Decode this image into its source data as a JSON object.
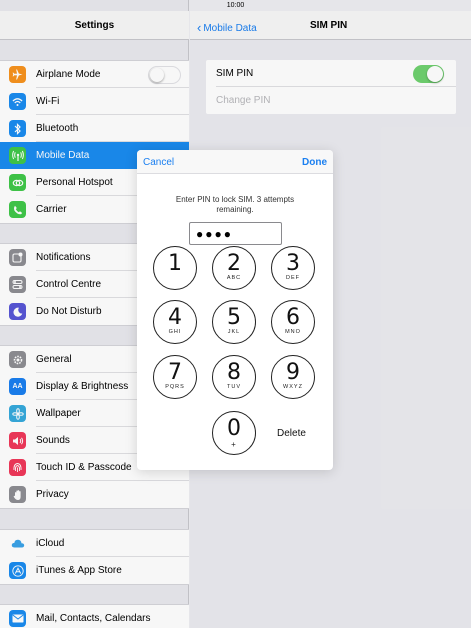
{
  "status_bar": {
    "signal": "●●●●●",
    "time": "10:00"
  },
  "left_panel": {
    "title": "Settings",
    "groups": [
      {
        "items": [
          {
            "label": "Airplane Mode",
            "icon": "airplane-icon",
            "color": "#f7931e"
          },
          {
            "label": "Wi-Fi",
            "icon": "wifi-icon",
            "color": "#1a8cf0"
          },
          {
            "label": "Bluetooth",
            "icon": "bluetooth-icon",
            "color": "#1a8cf0"
          },
          {
            "label": "Mobile Data",
            "icon": "antenna-icon",
            "color": "#41c84a"
          },
          {
            "label": "Personal Hotspot",
            "icon": "hotspot-icon",
            "color": "#41c84a"
          },
          {
            "label": "Carrier",
            "icon": "phone-icon",
            "color": "#41c84a"
          }
        ]
      },
      {
        "items": [
          {
            "label": "Notifications",
            "icon": "notifications-icon",
            "color": "#8e8e93"
          },
          {
            "label": "Control Centre",
            "icon": "control-centre-icon",
            "color": "#8e8e93"
          },
          {
            "label": "Do Not Disturb",
            "icon": "moon-icon",
            "color": "#5856d6"
          }
        ]
      },
      {
        "items": [
          {
            "label": "General",
            "icon": "gear-icon",
            "color": "#8e8e93"
          },
          {
            "label": "Display & Brightness",
            "icon": "text-size-icon",
            "color": "#1a7ff0"
          },
          {
            "label": "Wallpaper",
            "icon": "wallpaper-icon",
            "color": "#36aadc"
          },
          {
            "label": "Sounds",
            "icon": "speaker-icon",
            "color": "#f0385a"
          },
          {
            "label": "Touch ID & Passcode",
            "icon": "fingerprint-icon",
            "color": "#f0385a"
          },
          {
            "label": "Privacy",
            "icon": "hand-icon",
            "color": "#8e8e93"
          }
        ]
      },
      {
        "items": [
          {
            "label": "iCloud",
            "icon": "cloud-icon",
            "color": "#ffffff"
          },
          {
            "label": "iTunes & App Store",
            "icon": "app-store-icon",
            "color": "#1a8cf0"
          }
        ]
      },
      {
        "items": [
          {
            "label": "Mail, Contacts, Calendars",
            "icon": "mail-icon",
            "color": "#1a8cf0"
          }
        ]
      }
    ],
    "selected": "Mobile Data"
  },
  "right_panel": {
    "back_label": "Mobile Data",
    "title": "SIM PIN",
    "rows": [
      {
        "label": "SIM PIN",
        "toggle": "on"
      },
      {
        "label": "Change PIN",
        "disabled": true
      }
    ]
  },
  "pin_modal": {
    "cancel_label": "Cancel",
    "done_label": "Done",
    "prompt": "Enter PIN to lock SIM. 3 attempts remaining.",
    "pin_mask": "●●●●",
    "keys": [
      {
        "n": "1",
        "s": ""
      },
      {
        "n": "2",
        "s": "ABC"
      },
      {
        "n": "3",
        "s": "DEF"
      },
      {
        "n": "4",
        "s": "GHI"
      },
      {
        "n": "5",
        "s": "JKL"
      },
      {
        "n": "6",
        "s": "MNO"
      },
      {
        "n": "7",
        "s": "PQRS"
      },
      {
        "n": "8",
        "s": "TUV"
      },
      {
        "n": "9",
        "s": "WXYZ"
      },
      {
        "n": "0",
        "s": "+"
      }
    ],
    "delete_label": "Delete"
  }
}
